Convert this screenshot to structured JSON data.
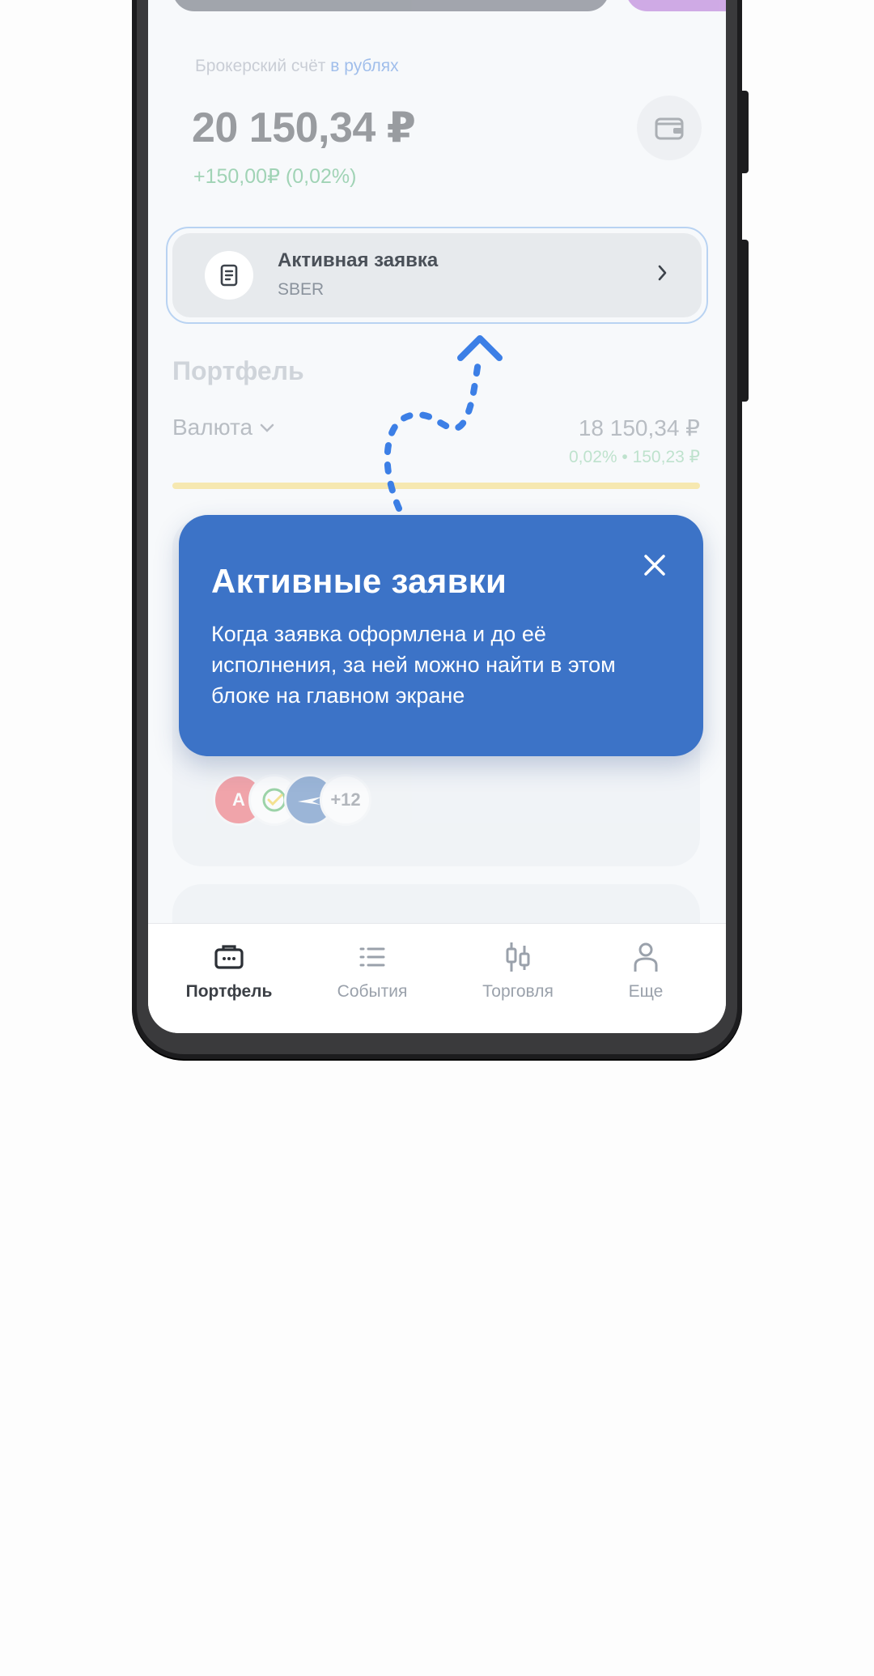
{
  "account": {
    "label": "Брокерский счёт",
    "currency_link": "в рублях",
    "balance": "20 150,34 ₽",
    "change": "+150,00₽ (0,02%)"
  },
  "active_order": {
    "title": "Активная заявка",
    "ticker": "SBER"
  },
  "portfolio": {
    "title": "Портфель",
    "currency_label": "Валюта",
    "currency_value": "18 150,34 ₽",
    "currency_change": "0,02% • 150,23 ₽",
    "progress_fraction": 1.0,
    "more_count": "+12"
  },
  "tooltip": {
    "title": "Активные заявки",
    "text": "Когда заявка оформлена и до её исполнения, за ней можно найти в этом блоке на главном экране"
  },
  "nav": {
    "items": [
      {
        "label": "Портфель",
        "icon": "briefcase-icon",
        "active": true
      },
      {
        "label": "События",
        "icon": "list-icon",
        "active": false
      },
      {
        "label": "Торговля",
        "icon": "candles-icon",
        "active": false
      },
      {
        "label": "Еще",
        "icon": "person-icon",
        "active": false
      }
    ]
  },
  "colors": {
    "tooltip_bg": "#3c73c7",
    "accent_link": "#2b6fd6",
    "positive": "#2aa157"
  }
}
